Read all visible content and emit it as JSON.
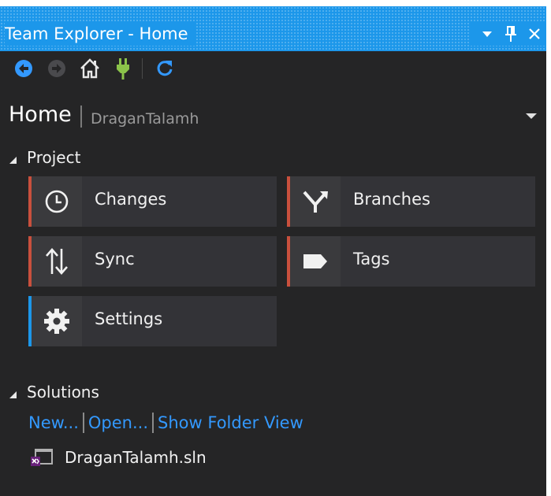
{
  "window": {
    "title": "Team Explorer - Home",
    "controls": {
      "dropdown": "▼",
      "pin": "⊥",
      "close": "✕"
    }
  },
  "toolbar": {
    "icons": [
      "back-arrow-icon",
      "forward-arrow-icon",
      "home-icon",
      "connect-plug-icon",
      "refresh-icon"
    ]
  },
  "header": {
    "title": "Home",
    "subtitle": "DraganTalamh"
  },
  "project": {
    "section_label": "Project",
    "tiles": [
      {
        "label": "Changes",
        "icon": "clock-icon",
        "accent": "#c9503d"
      },
      {
        "label": "Branches",
        "icon": "branch-icon",
        "accent": "#c9503d"
      },
      {
        "label": "Sync",
        "icon": "sync-arrows-icon",
        "accent": "#c9503d"
      },
      {
        "label": "Tags",
        "icon": "tag-icon",
        "accent": "#c9503d"
      },
      {
        "label": "Settings",
        "icon": "gear-icon",
        "accent": "#1c97ea"
      }
    ]
  },
  "solutions": {
    "section_label": "Solutions",
    "links": [
      "New...",
      "Open...",
      "Show Folder View"
    ],
    "items": [
      {
        "name": "DraganTalamh.sln",
        "icon": "solution-file-icon"
      }
    ]
  },
  "colors": {
    "title_bar": "#1c97ea",
    "background": "#252526",
    "tile": "#333337",
    "link": "#3399ff",
    "git_accent": "#c9503d",
    "settings_accent": "#1c97ea"
  }
}
